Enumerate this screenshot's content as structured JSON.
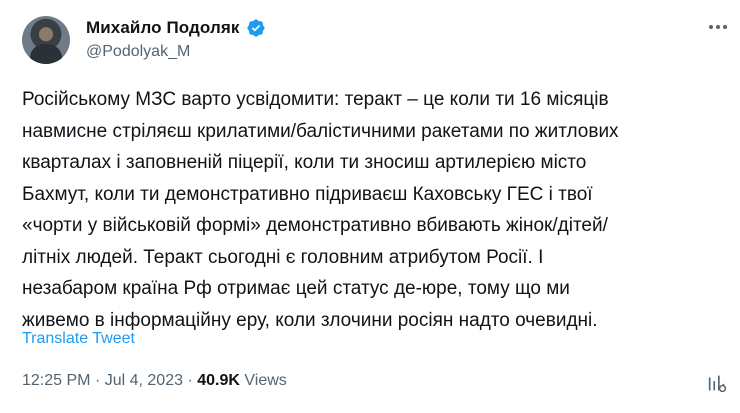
{
  "author": {
    "name": "Михайло Подоляк",
    "handle": "@Podolyak_M",
    "verified": true
  },
  "tweet": {
    "text": "Російському МЗС варто усвідомити: теракт – це коли ти 16 місяців\nнавмисне стріляєш крилатими/балістичними ракетами по житлових\nкварталах і заповненій піцерії, коли ти зносиш артилерією місто\nБахмут, коли ти демонстративно підриваєш Каховську ГЕС і твої\n«чорти у військовій формі» демонстративно вбивають жінок/дітей/\nлітніх людей. Теракт сьогодні є головним атрибутом Росії. І\nнезабаром країна Рф отримає цей статус де-юре, тому що ми\nживемо в інформаційну еру, коли злочини росіян надто очевидні.",
    "translate_label": "Translate Tweet",
    "time": "12:25 PM",
    "separator": "·",
    "date": "Jul 4, 2023",
    "views_count": "40.9K",
    "views_label": "Views"
  },
  "colors": {
    "verified": "#1d9bf0",
    "link": "#1d9bf0",
    "secondary_text": "#536471"
  },
  "icons": {
    "verified": "verified-badge-icon",
    "more": "more-options-icon",
    "analytics": "analytics-icon"
  }
}
